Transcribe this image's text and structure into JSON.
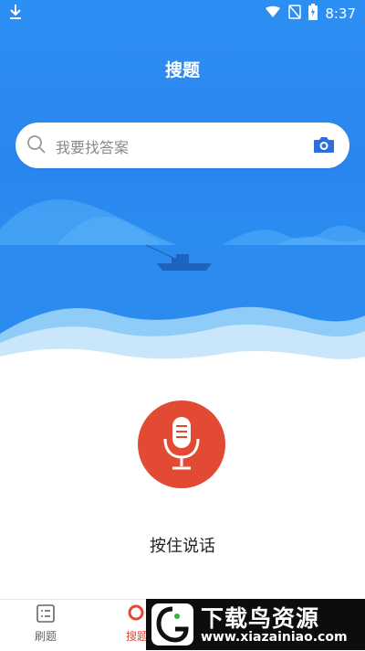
{
  "status_bar": {
    "time": "8:37"
  },
  "header": {
    "title": "搜题"
  },
  "search": {
    "placeholder": "我要找答案"
  },
  "voice": {
    "hold_label": "按住说话"
  },
  "bottom_nav": {
    "items": [
      {
        "label": "刷题",
        "icon": "list-icon",
        "active": false
      },
      {
        "label": "搜题",
        "icon": "search-tab-icon",
        "active": true
      }
    ]
  },
  "watermark": {
    "title": "下载鸟资源",
    "url": "www.xiazainiao.com"
  },
  "colors": {
    "hero_blue": "#2c8ff3",
    "accent_red": "#e24a33",
    "camera_blue": "#2b6fdd"
  }
}
